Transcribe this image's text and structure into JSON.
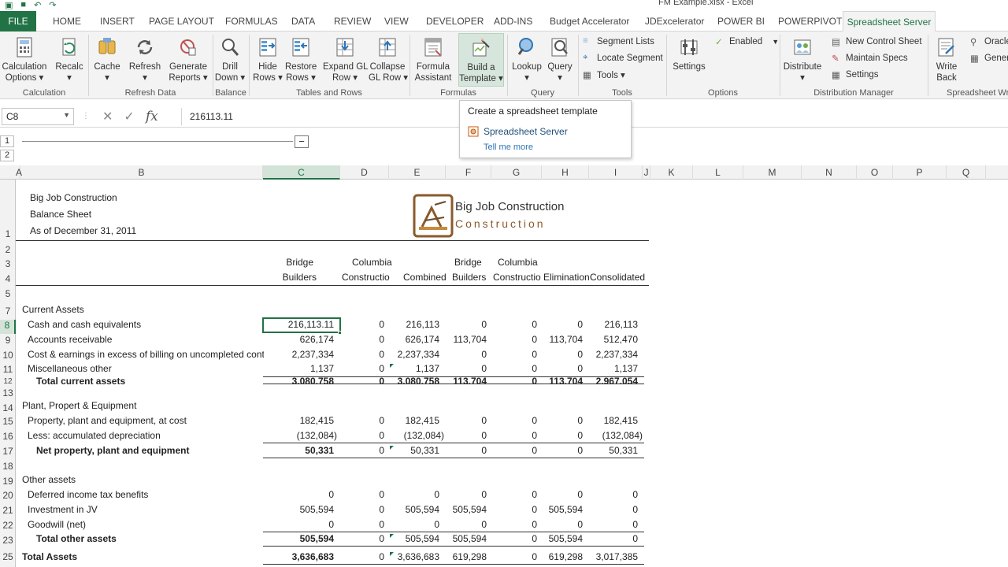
{
  "window": {
    "title": "FM Example.xlsx - Excel"
  },
  "tabs": [
    "FILE",
    "HOME",
    "INSERT",
    "PAGE LAYOUT",
    "FORMULAS",
    "DATA",
    "REVIEW",
    "VIEW",
    "DEVELOPER",
    "ADD-INS",
    "Budget Accelerator",
    "JDExcelerator",
    "POWER BI",
    "POWERPIVOT",
    "Spreadsheet Server"
  ],
  "ribbon": {
    "groups": {
      "calculation": "Calculation",
      "refresh": "Refresh Data",
      "balance": "Balance",
      "tables": "Tables and Rows",
      "formulas": "Formulas",
      "query": "Query",
      "tools": "Tools",
      "options": "Options",
      "distribution": "Distribution Manager",
      "spreadsheet_wr": "Spreadsheet Wr"
    },
    "buttons": {
      "calc_options_1": "Calculation",
      "calc_options_2": "Options ▾",
      "recalc_1": "Recalc",
      "recalc_2": "▾",
      "cache_1": "Cache",
      "cache_2": "▾",
      "refresh_1": "Refresh",
      "refresh_2": "▾",
      "generate_1": "Generate",
      "generate_2": "Reports ▾",
      "drill_1": "Drill",
      "drill_2": "Down ▾",
      "hide_1": "Hide",
      "hide_2": "Rows ▾",
      "restore_1": "Restore",
      "restore_2": "Rows ▾",
      "expand_1": "Expand GL",
      "expand_2": "Row ▾",
      "collapse_1": "Collapse",
      "collapse_2": "GL Row ▾",
      "formula_1": "Formula",
      "formula_2": "Assistant",
      "build_1": "Build a",
      "build_2": "Template ▾",
      "lookup_1": "Lookup",
      "lookup_2": "▾",
      "query_1": "Query",
      "query_2": "▾",
      "settings": "Settings",
      "distribute_1": "Distribute",
      "distribute_2": "▾",
      "write_1": "Write",
      "write_2": "Back"
    },
    "small": {
      "segment_lists": "Segment Lists",
      "locate_segment": "Locate Segment",
      "tools": "Tools ▾",
      "enabled": "Enabled",
      "new_control_sheet": "New Control Sheet",
      "maintain_specs": "Maintain Specs",
      "dm_settings": "Settings",
      "oracle": "Oracle",
      "gener": "Gener"
    }
  },
  "formula_bar": {
    "name_box": "C8",
    "value": "216113.11"
  },
  "outline": {
    "levels": [
      "1",
      "2"
    ],
    "collapse": "−"
  },
  "columns": [
    "A",
    "B",
    "C",
    "D",
    "E",
    "F",
    "G",
    "H",
    "I",
    "J",
    "K",
    "L",
    "M",
    "N",
    "O",
    "P",
    "Q"
  ],
  "rows": [
    "1",
    "2",
    "3",
    "4",
    "5",
    "7",
    "8",
    "9",
    "10",
    "11",
    "12",
    "13",
    "14",
    "15",
    "16",
    "17",
    "18",
    "19",
    "20",
    "21",
    "22",
    "23",
    "25"
  ],
  "tooltip": {
    "title": "Create a spreadsheet template",
    "item": "Spreadsheet Server",
    "more": "Tell me more"
  },
  "report": {
    "company": "Big Job Construction",
    "statement": "Balance Sheet",
    "date": "As of December 31, 2011",
    "logo_line1": "Big Job Construction",
    "logo_line2": "Construction",
    "headers": {
      "c1": "Bridge",
      "c2": "Builders",
      "d1": "Columbia",
      "d2": "Constructio",
      "e2": "Combined",
      "f1": "Bridge",
      "f2": "Builders",
      "g1": "Columbia",
      "g2": "Constructio",
      "h2": "Elimination",
      "i2": "Consolidated"
    },
    "sections": {
      "current_assets": "Current Assets",
      "ppe": "Plant, Propert & Equipment",
      "other_assets": "Other assets"
    },
    "lines": [
      {
        "label": "Cash and cash equivalents",
        "c": "216,113.11",
        "d": "0",
        "e": "216,113",
        "f": "0",
        "g": "0",
        "h": "0",
        "i": "216,113"
      },
      {
        "label": "Accounts receivable",
        "c": "626,174",
        "d": "0",
        "e": "626,174",
        "f": "113,704",
        "g": "0",
        "h": "113,704",
        "i": "512,470"
      },
      {
        "label": "Cost & earnings in excess of billing on uncompleted contra",
        "c": "2,237,334",
        "d": "0",
        "e": "2,237,334",
        "f": "0",
        "g": "0",
        "h": "0",
        "i": "2,237,334"
      },
      {
        "label": "Miscellaneous other",
        "c": "1,137",
        "d": "0",
        "e": "1,137",
        "f": "0",
        "g": "0",
        "h": "0",
        "i": "1,137"
      },
      {
        "label": "Total current assets",
        "c": "3,080,758",
        "d": "0",
        "e": "3,080,758",
        "f": "113,704",
        "g": "0",
        "h": "113,704",
        "i": "2,967,054"
      },
      {
        "label": "Property, plant and equipment, at cost",
        "c": "182,415",
        "d": "0",
        "e": "182,415",
        "f": "0",
        "g": "0",
        "h": "0",
        "i": "182,415"
      },
      {
        "label": "Less: accumulated depreciation",
        "c": "(132,084)",
        "d": "0",
        "e": "(132,084)",
        "f": "0",
        "g": "0",
        "h": "0",
        "i": "(132,084)"
      },
      {
        "label": "Net property, plant and equipment",
        "c": "50,331",
        "d": "0",
        "e": "50,331",
        "f": "0",
        "g": "0",
        "h": "0",
        "i": "50,331"
      },
      {
        "label": "Deferred income tax benefits",
        "c": "0",
        "d": "0",
        "e": "0",
        "f": "0",
        "g": "0",
        "h": "0",
        "i": "0"
      },
      {
        "label": "Investment in JV",
        "c": "505,594",
        "d": "0",
        "e": "505,594",
        "f": "505,594",
        "g": "0",
        "h": "505,594",
        "i": "0"
      },
      {
        "label": "Goodwill (net)",
        "c": "0",
        "d": "0",
        "e": "0",
        "f": "0",
        "g": "0",
        "h": "0",
        "i": "0"
      },
      {
        "label": "Total other assets",
        "c": "505,594",
        "d": "0",
        "e": "505,594",
        "f": "505,594",
        "g": "0",
        "h": "505,594",
        "i": "0"
      },
      {
        "label": "Total Assets",
        "c": "3,636,683",
        "d": "0",
        "e": "3,636,683",
        "f": "619,298",
        "g": "0",
        "h": "619,298",
        "i": "3,017,385"
      }
    ]
  }
}
